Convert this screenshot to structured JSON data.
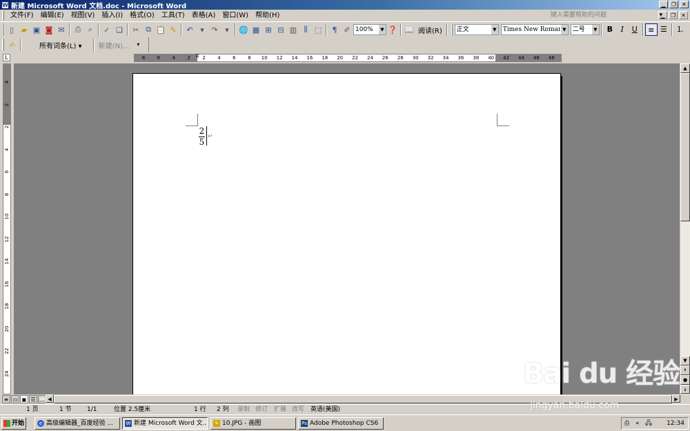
{
  "window": {
    "title": "新建 Microsoft Word 文档.doc - Microsoft Word",
    "icon": "word-app-icon"
  },
  "menu": {
    "items": [
      "文件(F)",
      "编辑(E)",
      "视图(V)",
      "插入(I)",
      "格式(O)",
      "工具(T)",
      "表格(A)",
      "窗口(W)",
      "帮助(H)"
    ],
    "help_placeholder": "键入需要帮助的问题"
  },
  "toolbar": {
    "zoom": "100%",
    "read_label": "阅读(R)",
    "style": "正文",
    "font": "Times New Roman",
    "size": "二号"
  },
  "toolbar2": {
    "all_entries": "所有词条(L) ▾",
    "new_entry": "新建(N)..."
  },
  "ruler": {
    "h_ticks": [
      "8",
      "6",
      "4",
      "2",
      "2",
      "4",
      "6",
      "8",
      "10",
      "12",
      "14",
      "16",
      "18",
      "20",
      "22",
      "24",
      "26",
      "28",
      "30",
      "32",
      "34",
      "36",
      "38",
      "40",
      "42",
      "44",
      "46",
      "48"
    ],
    "v_ticks": [
      "4",
      "2",
      "2",
      "4",
      "6",
      "8",
      "10",
      "12",
      "14",
      "16",
      "18",
      "20",
      "22",
      "24"
    ]
  },
  "document": {
    "numerator": "2",
    "denominator": "5",
    "paragraph_mark": "↵"
  },
  "status": {
    "page": "1 页",
    "section": "1 节",
    "page_of": "1/1",
    "position": "位置 2.5厘米",
    "line": "1 行",
    "column": "2 列",
    "rec": "录制",
    "trk": "修订",
    "ext": "扩展",
    "ovr": "改写",
    "language": "英语(美国)"
  },
  "taskbar": {
    "start": "开始",
    "tasks": [
      {
        "label": "高级编辑器_百度经验 ..."
      },
      {
        "label": "新建 Microsoft Word 文..."
      },
      {
        "label": "10.JPG - 画图"
      },
      {
        "label": "Adobe Photoshop CS6"
      }
    ],
    "clock": "12:34"
  },
  "watermark": {
    "logo": "Bai du 经验",
    "url": "jingyan.baidu.com"
  },
  "colors": {
    "titlebar_start": "#0a246a",
    "titlebar_end": "#a6caf0",
    "workspace": "#808080",
    "chrome": "#d4d0c8"
  }
}
